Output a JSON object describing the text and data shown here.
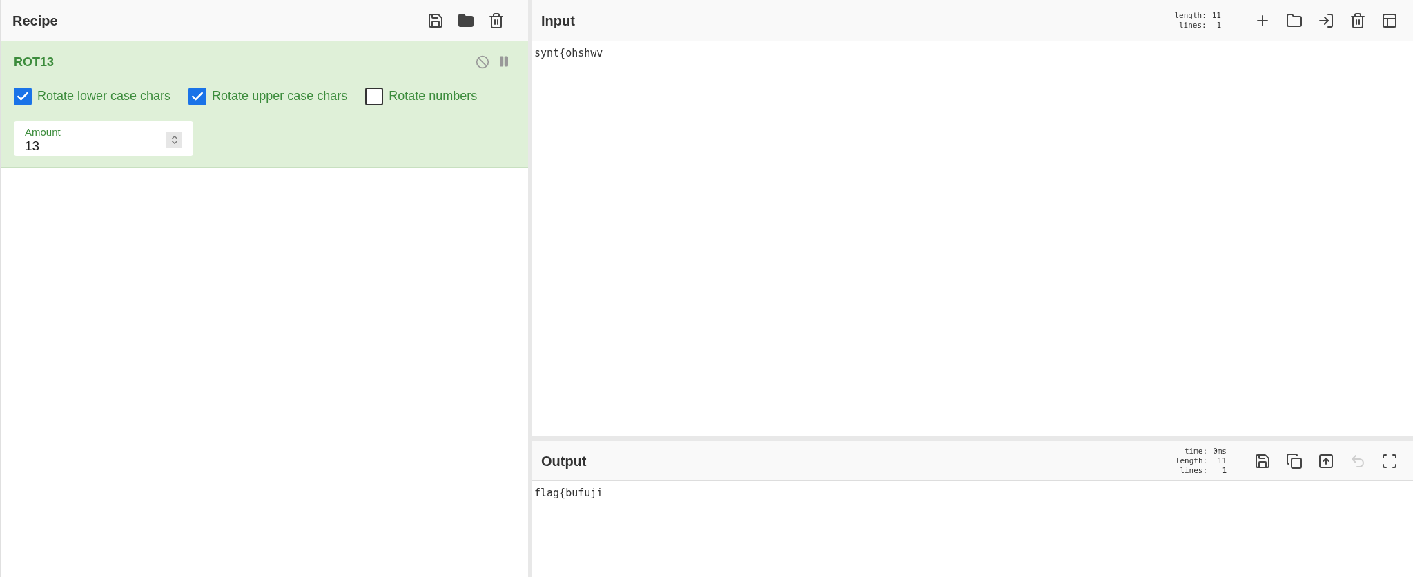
{
  "recipe": {
    "title": "Recipe",
    "operations": [
      {
        "name": "ROT13",
        "options": [
          {
            "kind": "checkbox",
            "label": "Rotate lower case chars",
            "checked": true
          },
          {
            "kind": "checkbox",
            "label": "Rotate upper case chars",
            "checked": true
          },
          {
            "kind": "checkbox",
            "label": "Rotate numbers",
            "checked": false
          },
          {
            "kind": "number",
            "label": "Amount",
            "value": "13"
          }
        ]
      }
    ]
  },
  "input": {
    "title": "Input",
    "stats": [
      {
        "label": "length:",
        "value": "11"
      },
      {
        "label": "lines:",
        "value": "1"
      }
    ],
    "text": "synt{ohshwv"
  },
  "output": {
    "title": "Output",
    "stats": [
      {
        "label": "time:",
        "value": "0ms"
      },
      {
        "label": "length:",
        "value": "11"
      },
      {
        "label": "lines:",
        "value": "1"
      }
    ],
    "undo_disabled": true,
    "text": "flag{bufuji"
  }
}
